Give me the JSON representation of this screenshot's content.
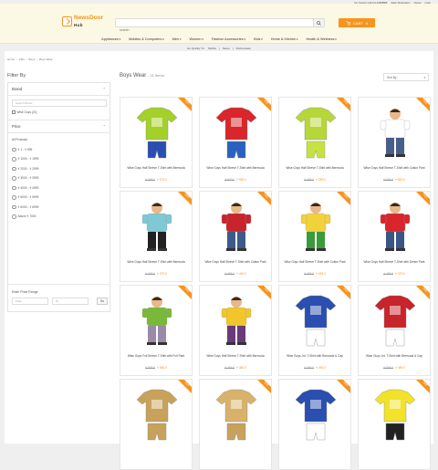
{
  "top_links": [
    "For Queries Call 011-40598888",
    "Seller Registration",
    "Signup",
    "Login"
  ],
  "logo": {
    "line1": "NewsDoor",
    "line2": "Hub"
  },
  "search": {
    "placeholder": "search"
  },
  "cart": {
    "label": "CART",
    "count": "0"
  },
  "nav": [
    "Appliances",
    "Mobiles & Computers",
    "Men",
    "Women",
    "Fashion Accessories",
    "Kids",
    "Home & Kitchen",
    "Health & Wellness"
  ],
  "subnav": [
    "Go Quickly To :",
    "Mobile",
    "Saree",
    "Kitchenware"
  ],
  "breadcrumb": [
    "Home",
    "Kids",
    "Boys",
    "Boys Wear"
  ],
  "filter": {
    "title": "Filter By",
    "brand_label": "Brand",
    "brand_search": "Search Brand",
    "brand_option": "Wise Guys (21)",
    "price_label": "Price",
    "price_options": [
      "All Products",
      "₹ 1 - ₹ 999",
      "₹ 1000 - ₹ 1999",
      "₹ 2000 - ₹ 2999",
      "₹ 3000 - ₹ 3999",
      "₹ 4000 - ₹ 4999",
      "₹ 5000 - ₹ 5999",
      "₹ 6000 - ₹ 6999",
      "Above ₹ 7000"
    ],
    "range_label": "Enter Price Range",
    "from_placeholder": "From",
    "to_placeholder": "To",
    "go": "Go"
  },
  "results": {
    "title": "Boys Wear",
    "count": "- 21 Items",
    "sort": "Sort By :"
  },
  "products": [
    {
      "name": "Wise Guys Half Sleeve T-Shirt with Bermuda",
      "old": "₹ 465.0",
      "price": "₹ 373.0",
      "shirt": "#a4d02a",
      "pant": "#2a4fb0"
    },
    {
      "name": "Wise Guys Half Sleeve T-Shirt with Bermuda",
      "old": "₹ 570.0",
      "price": "₹ 555.0",
      "shirt": "#d8262b",
      "pant": "#2a61c0"
    },
    {
      "name": "Wise Guys Half Sleeve T-Shirt with Bermuda",
      "old": "₹ 465.0",
      "price": "₹ 399.0",
      "shirt": "#b7d63a",
      "pant": "#c6e142"
    },
    {
      "name": "Wise Guys Half Sleeve T-Shirt with Cotton Pant",
      "old": "₹ 665.0",
      "price": "₹ 553.0",
      "shirt": "#ffffff",
      "pant": "#4a5e8a"
    },
    {
      "name": "Wise Guys Half Sleeve T-Shirt with Bermuda",
      "old": "₹ 465.0",
      "price": "₹ 373.0",
      "shirt": "#7fc8d6",
      "pant": "#222222"
    },
    {
      "name": "Wise Guys Half Sleeve T-Shirt with Cotton Pant",
      "old": "₹ 465.0",
      "price": "₹ 495.0",
      "shirt": "#c8242b",
      "pant": "#3e5a8a"
    },
    {
      "name": "Wise Guys Half Sleeve T-Shirt with Cotton Pant",
      "old": "₹ 465.0",
      "price": "₹ 495.0",
      "shirt": "#f2d23a",
      "pant": "#3b9b3a"
    },
    {
      "name": "Wise Guys Half Sleeve T-Shirt with Denim Pant",
      "old": "₹ 465.0",
      "price": "₹ 475.0",
      "shirt": "#d8262b",
      "pant": "#3b5584"
    },
    {
      "name": "Wise Guys Full Sleeve T-Shirt with Full Pant",
      "old": "₹ 595.0",
      "price": "₹ 556.0",
      "shirt": "#7ab83a",
      "pant": "#9a8aa8"
    },
    {
      "name": "Wise Guys Half Sleeve T-Shirt with Bermuda",
      "old": "₹ 465.0",
      "price": "₹ 385.0",
      "shirt": "#f2c62a",
      "pant": "#6a3a7a"
    },
    {
      "name": "Wise Guys Jnt. T-Shirt with Bermuda & Cap",
      "old": "₹ 595.0",
      "price": "₹ 495.0",
      "shirt": "#2a4fb0",
      "pant": "#ffffff"
    },
    {
      "name": "Wise Guys Jnt. T-Shirt with Bermuda & Cap",
      "old": "₹ 595.0",
      "price": "₹ 495.0",
      "shirt": "#c8242b",
      "pant": "#ffffff"
    },
    {
      "name": "",
      "old": "",
      "price": "",
      "shirt": "#c8a25a",
      "pant": "#c8a25a"
    },
    {
      "name": "",
      "old": "",
      "price": "",
      "shirt": "#d8b26a",
      "pant": "#c8a25a"
    },
    {
      "name": "",
      "old": "",
      "price": "",
      "shirt": "#2a4fb0",
      "pant": "#ffffff"
    },
    {
      "name": "",
      "old": "",
      "price": "",
      "shirt": "#f2e22a",
      "pant": "#222222"
    }
  ],
  "ribbon_label": "SALE",
  "accent": "#f7941d"
}
